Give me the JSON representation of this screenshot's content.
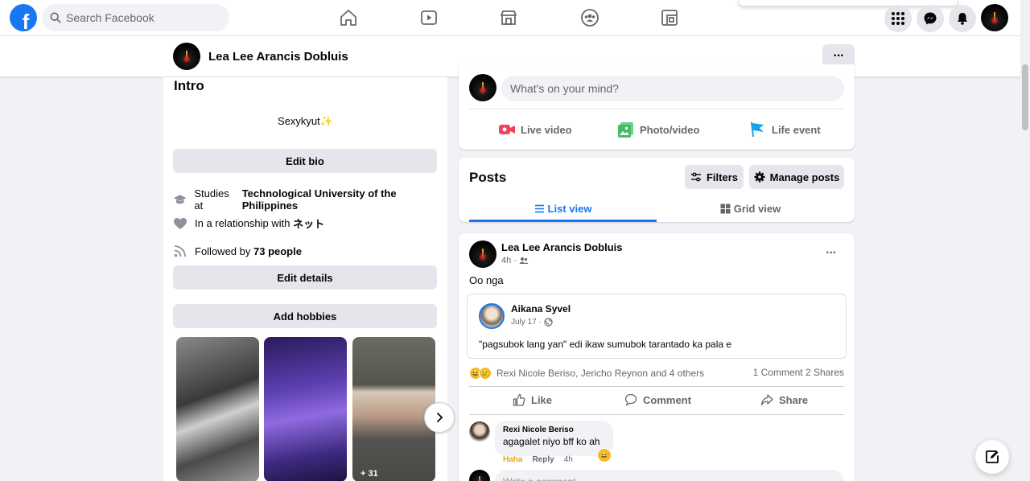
{
  "topnav": {
    "logo_letter": "f",
    "search_placeholder": "Search Facebook",
    "nav_icons": [
      "home-icon",
      "watch-icon",
      "marketplace-icon",
      "groups-icon",
      "gaming-icon"
    ],
    "right_icons": [
      "menu-grid-icon",
      "messenger-icon",
      "notifications-icon",
      "account-avatar"
    ]
  },
  "profile_header": {
    "name": "Lea Lee Arancis Dobluis",
    "more_label": "···"
  },
  "intro": {
    "title": "Intro",
    "bio": "Sexykyut✨",
    "edit_bio": "Edit bio",
    "studies_prefix": "Studies at ",
    "studies_school": "Technological University of the Philippines",
    "relationship_prefix": "In a relationship with ",
    "relationship_partner": "ネット",
    "followed_prefix": "Followed by ",
    "followed_count": "73 people",
    "edit_details": "Edit details",
    "add_hobbies": "Add hobbies",
    "photos_more": "+ 31"
  },
  "composer": {
    "placeholder": "What's on your mind?",
    "live_video": "Live video",
    "photo_video": "Photo/video",
    "life_event": "Life event"
  },
  "posts_header": {
    "title": "Posts",
    "filters": "Filters",
    "manage_posts": "Manage posts",
    "list_view": "List view",
    "grid_view": "Grid view"
  },
  "post": {
    "author": "Lea Lee Arancis Dobluis",
    "time": "4h",
    "dot": "·",
    "text": "Oo nga",
    "more_label": "···",
    "shared": {
      "author": "Aikana Syvel",
      "time": "July 17",
      "dot": "·",
      "text": "\"pagsubok lang yan\" edi ikaw sumubok tarantado ka pala e"
    },
    "reactions_text": "Rexi Nicole Beriso, Jericho Reynon and 4 others",
    "stats": "1 Comment  2 Shares",
    "like": "Like",
    "comment": "Comment",
    "share": "Share",
    "comment_item": {
      "author": "Rexi Nicole Beriso",
      "text": "agagalet niyo bff ko ah",
      "reaction_label": "Haha",
      "reply": "Reply",
      "time": "4h"
    },
    "write_comment_placeholder": "Write a comment..."
  },
  "colors": {
    "brand": "#1877f2",
    "background": "#f0f2f5",
    "button_gray": "#e4e6eb",
    "live_red": "#f3425f",
    "photo_green": "#45bd62",
    "life_blue": "#1ba3e8"
  }
}
